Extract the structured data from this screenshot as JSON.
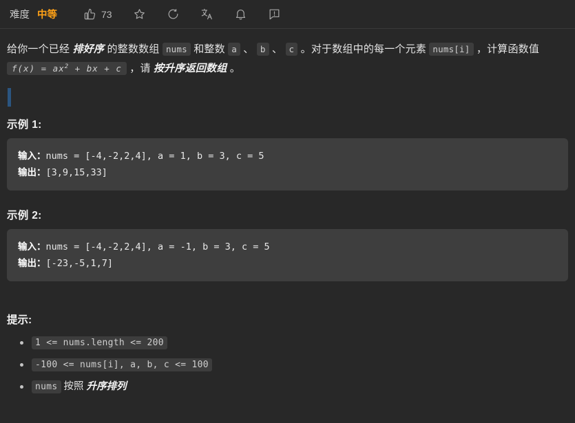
{
  "colors": {
    "page_bg": "#282828",
    "code_block_bg": "#3e3e3e",
    "inline_chip_bg": "#3d3d3d",
    "difficulty_accent": "#ffa116",
    "cursor_bar": "#2b5580",
    "text": "#e3e3e3"
  },
  "toolbar": {
    "difficulty_label": "难度",
    "difficulty_value": "中等",
    "vote_count": "73",
    "icons": {
      "like": "thumbs-up-icon",
      "favorite": "star-icon",
      "share": "share-refresh-icon",
      "translate": "translate-icon",
      "notification": "bell-icon",
      "feedback": "feedback-icon"
    }
  },
  "description": {
    "part1": "给你一个已经 ",
    "emphasis1": "排好序",
    "part2": " 的整数数组 ",
    "code_nums": "nums",
    "part3": " 和整数 ",
    "code_a": "a",
    "sep1": " 、 ",
    "code_b": "b",
    "sep2": " 、 ",
    "code_c": "c",
    "part4": " 。对于数组中的每一个元素 ",
    "code_numsi": "nums[i]",
    "part5": " ，计算函数值 ",
    "formula_prefix": "f(x) = ax",
    "formula_sup": "2",
    "formula_suffix": " + bx + c",
    "part6": " ，请 ",
    "emphasis2": "按升序返回数组",
    "part7": " 。"
  },
  "examples": [
    {
      "title": "示例 1:",
      "input_label": "输入：",
      "input_value": "nums = [-4,-2,2,4], a = 1, b = 3, c = 5",
      "output_label": "输出：",
      "output_value": "[3,9,15,33]"
    },
    {
      "title": "示例 2:",
      "input_label": "输入：",
      "input_value": "nums = [-4,-2,2,4], a = -1, b = 3, c = 5",
      "output_label": "输出：",
      "output_value": "[-23,-5,1,7]"
    }
  ],
  "hints": {
    "title": "提示:",
    "items": [
      {
        "type": "code",
        "code": "1 <= nums.length <= 200"
      },
      {
        "type": "code",
        "code": "-100 <= nums[i], a, b, c <= 100"
      },
      {
        "type": "mixed",
        "code": "nums",
        "text_plain": " 按照 ",
        "text_strong": "升序排列"
      }
    ]
  }
}
